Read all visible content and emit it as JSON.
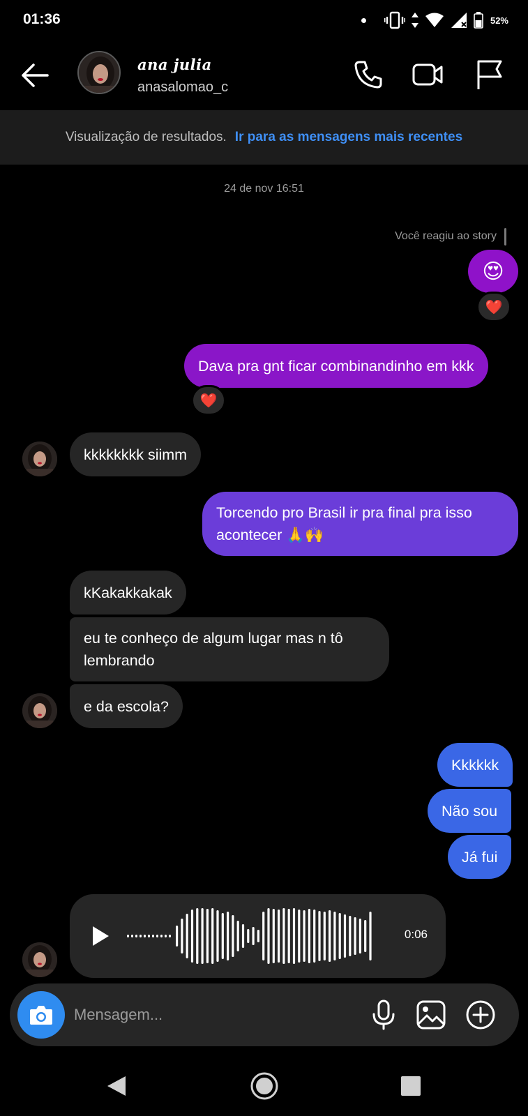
{
  "status_bar": {
    "time": "01:36",
    "battery": "52%"
  },
  "header": {
    "name": "ana julia",
    "username": "anasalomao_c"
  },
  "banner": {
    "label": "Visualização de resultados.",
    "link": "Ir para as mensagens mais recentes"
  },
  "date_divider": "24 de nov 16:51",
  "story_reaction": {
    "label": "Você reagiu ao story",
    "emoji": "😍",
    "reaction": "❤️"
  },
  "messages": [
    {
      "text": "Dava pra gnt ficar combinandinho em kkk",
      "reaction": "❤️"
    },
    {
      "text": "kkkkkkkk siimm"
    },
    {
      "text_line1": "Torcendo pro Brasil ir pra final pra isso",
      "text_line2": "acontecer 🙏🙌"
    },
    {
      "text": "kKakakkakak"
    },
    {
      "text_line1": "eu te conheço de algum lugar mas n tô",
      "text_line2": "lembrando"
    },
    {
      "text": "e da escola?"
    },
    {
      "text": "Kkkkkk"
    },
    {
      "text": "Não sou"
    },
    {
      "text": "Já fui"
    }
  ],
  "audio": {
    "duration": "0:06"
  },
  "composer": {
    "placeholder": "Mensagem..."
  },
  "colors": {
    "outgoing_purple": "#8a16c8",
    "outgoing_violet": "#6b3dd9",
    "outgoing_blue": "#3a67e6",
    "incoming": "#262626",
    "link": "#3f8ff5"
  }
}
